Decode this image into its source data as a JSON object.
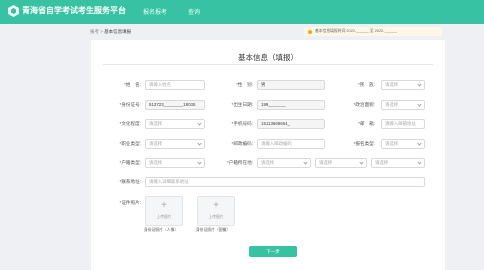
{
  "header": {
    "brand": "青海省自学考试考生服务平台",
    "nav": [
      "报名报考",
      "查询"
    ],
    "colors": {
      "accent": "#36c2a3"
    }
  },
  "breadcrumb": {
    "home": "报考",
    "sep": ">",
    "current": "基本信息填报"
  },
  "notice": {
    "text": "基本信息填报时间 2022-______ 至 2022-______"
  },
  "form": {
    "title": "基本信息（填报）",
    "labels": {
      "name": "*姓　名:",
      "gender": "*性　别:",
      "ethnicity": "*民　族:",
      "idno": "*身份证号:",
      "birth": "*出生日期:",
      "political": "*政治面貌:",
      "education": "*文化程度:",
      "phone": "*手机号码:",
      "email": "*邮　箱:",
      "occupation": "*职业类型:",
      "postcode": "*邮政编码:",
      "category": "*报名类型:",
      "household": "*户籍类型:",
      "region": "*户籍所在地:",
      "address": "*联系地址:",
      "cert": "*证件照片:"
    },
    "values": {
      "name_placeholder": "请输入姓名",
      "gender": "男",
      "ethnicity": "请选择",
      "idno": "513723________18035",
      "birth": "199_______",
      "political": "请选择",
      "education": "请选择",
      "phone": "15113669664_",
      "email_placeholder": "请输入邮箱地址",
      "occupation": "请选择",
      "postcode_placeholder": "请输入邮政编码",
      "category": "请选择",
      "household": "请选择",
      "region1": "请选择",
      "region2": "请选择",
      "region3": "请选择",
      "address_placeholder": "请输入详细联系地址"
    },
    "uploads": [
      {
        "plus": "+",
        "text": "上传图片",
        "caption": "身份证照片（人像）"
      },
      {
        "plus": "+",
        "text": "上传图片",
        "caption": "身份证照片（国徽）"
      }
    ],
    "next_button": "下一步"
  }
}
